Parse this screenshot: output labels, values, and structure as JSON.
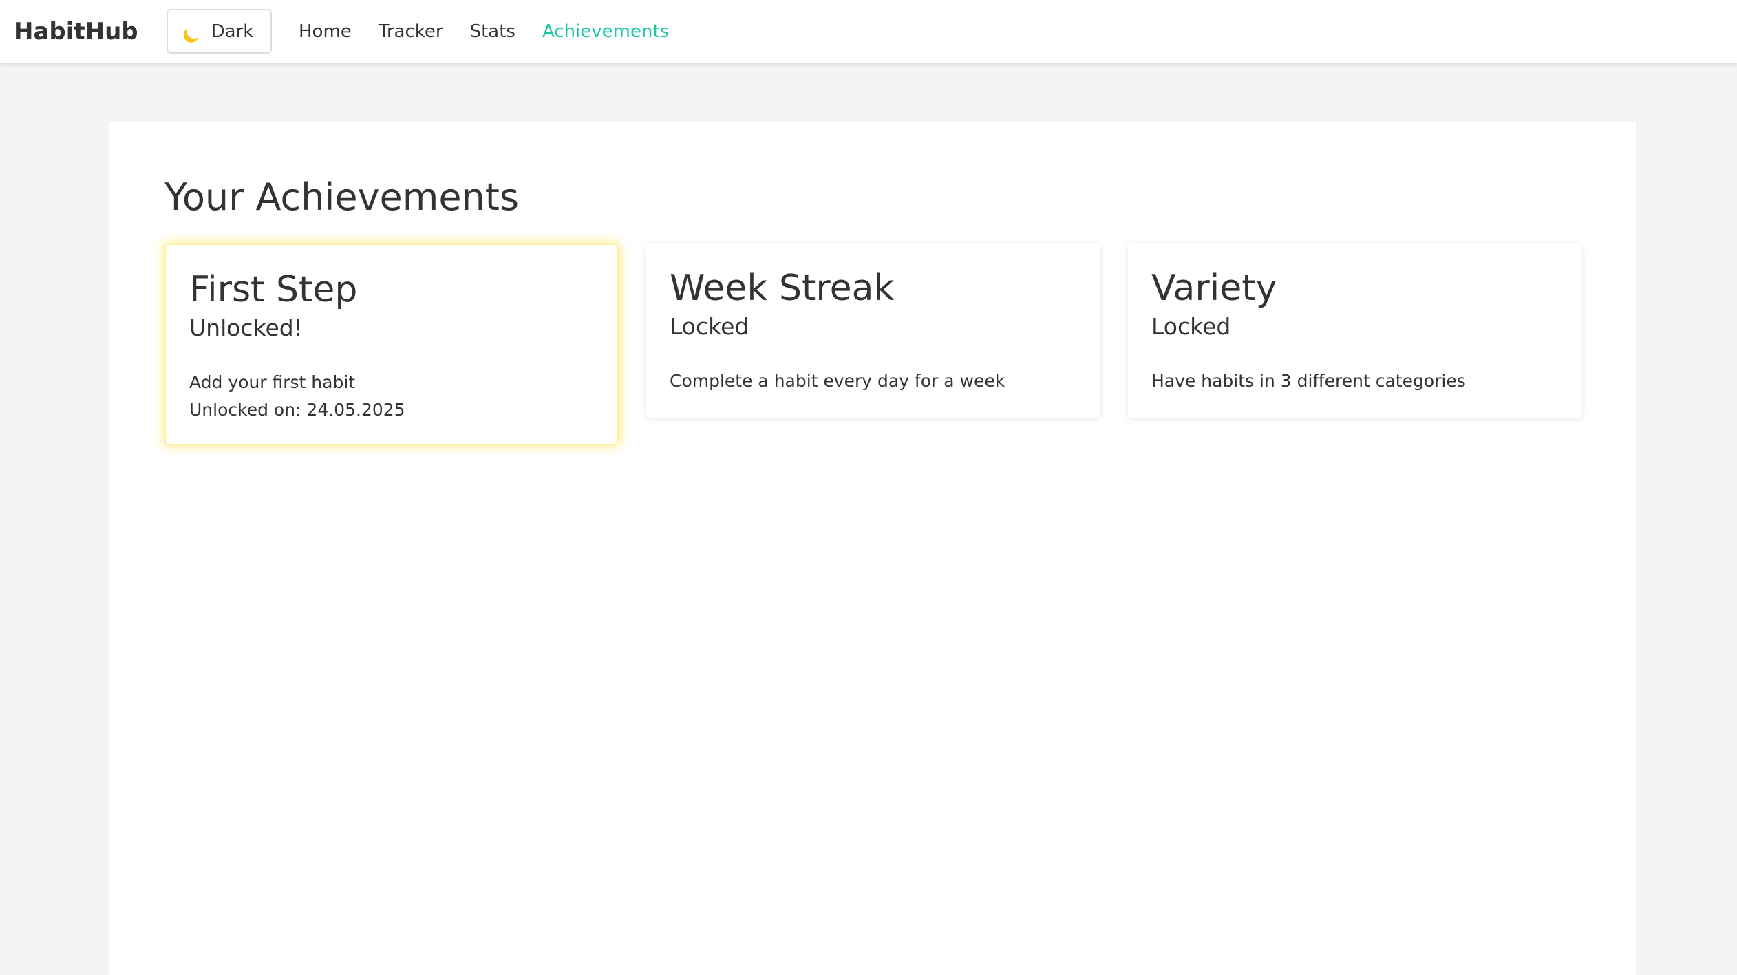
{
  "app": {
    "brand": "HabitHub",
    "theme_toggle_label": "Dark",
    "theme_toggle_icon": "moon-icon",
    "accent_color": "#1ec6a5",
    "unlocked_glow_color": "#ffde3c"
  },
  "nav": {
    "items": [
      {
        "label": "Home",
        "active": false
      },
      {
        "label": "Tracker",
        "active": false
      },
      {
        "label": "Stats",
        "active": false
      },
      {
        "label": "Achievements",
        "active": true
      }
    ]
  },
  "main": {
    "title": "Your Achievements",
    "achievements": [
      {
        "name": "First Step",
        "status": "Unlocked!",
        "description": "Add your first habit",
        "unlocked_on": "Unlocked on: 24.05.2025"
      },
      {
        "name": "Week Streak",
        "status": "Locked",
        "description": "Complete a habit every day for a week"
      },
      {
        "name": "Variety",
        "status": "Locked",
        "description": "Have habits in 3 different categories"
      }
    ]
  }
}
